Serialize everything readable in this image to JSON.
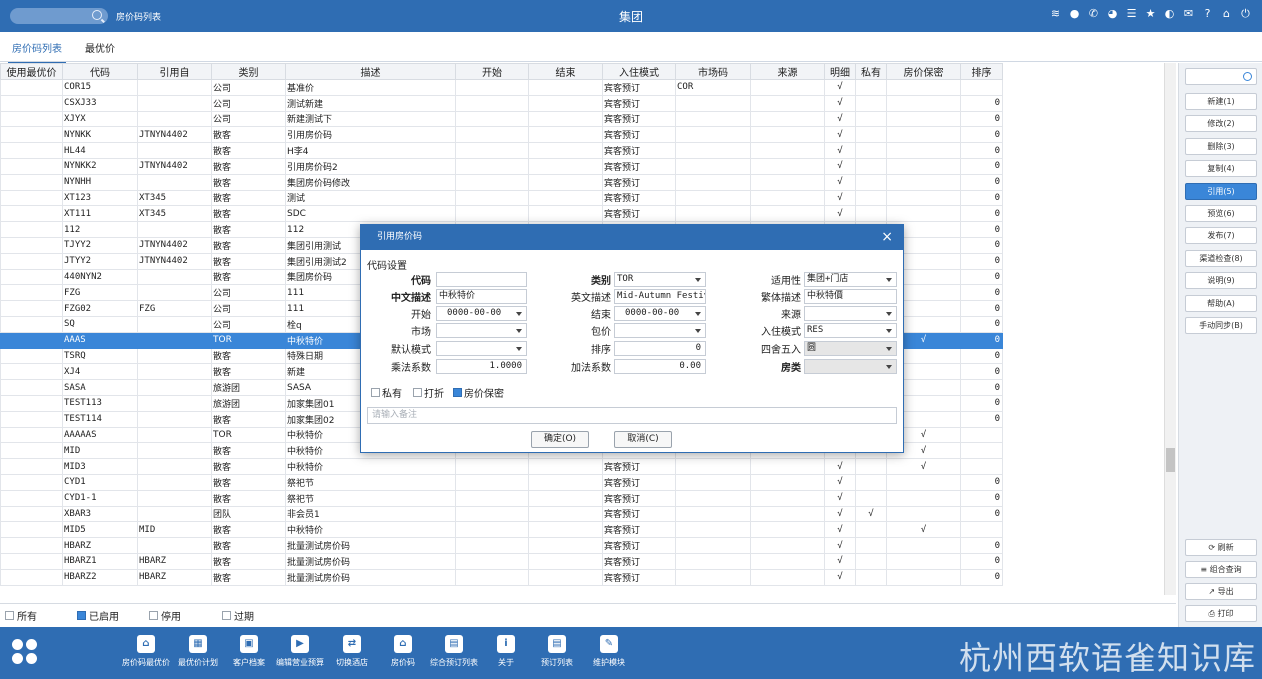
{
  "topbar": {
    "title": "房价码列表",
    "center_title": "集团",
    "icons": [
      "wifi-icon",
      "chat-icon",
      "phone-icon",
      "palette-icon",
      "menu-icon",
      "star-icon",
      "contrast-icon",
      "mail-icon",
      "help-icon",
      "home-icon",
      "power-icon"
    ]
  },
  "tabs": [
    "房价码列表",
    "最优价"
  ],
  "grid": {
    "columns": [
      "使用最优价",
      "代码",
      "引用自",
      "类别",
      "描述",
      "开始",
      "结束",
      "入住模式",
      "市场码",
      "来源",
      "明细",
      "私有",
      "房价保密",
      "排序"
    ],
    "rows": [
      {
        "code": "COR15",
        "ref": "",
        "cat": "公司",
        "desc": "基准价",
        "mode": "宾客预订",
        "market": "COR",
        "detail": "√",
        "private": "",
        "secret": "",
        "sort": ""
      },
      {
        "code": "CSXJ33",
        "ref": "",
        "cat": "公司",
        "desc": "测试新建",
        "mode": "宾客预订",
        "market": "",
        "detail": "√",
        "private": "",
        "secret": "",
        "sort": "0"
      },
      {
        "code": "XJYX",
        "ref": "",
        "cat": "公司",
        "desc": "新建测试下",
        "mode": "宾客预订",
        "market": "",
        "detail": "√",
        "private": "",
        "secret": "",
        "sort": "0"
      },
      {
        "code": "NYNKK",
        "ref": "JTNYN4402",
        "cat": "散客",
        "desc": "引用房价码",
        "mode": "宾客预订",
        "market": "",
        "detail": "√",
        "private": "",
        "secret": "",
        "sort": "0"
      },
      {
        "code": "HL44",
        "ref": "",
        "cat": "散客",
        "desc": "H李4",
        "mode": "宾客预订",
        "market": "",
        "detail": "√",
        "private": "",
        "secret": "",
        "sort": "0"
      },
      {
        "code": "NYNKK2",
        "ref": "JTNYN4402",
        "cat": "散客",
        "desc": "引用房价码2",
        "mode": "宾客预订",
        "market": "",
        "detail": "√",
        "private": "",
        "secret": "",
        "sort": "0"
      },
      {
        "code": "NYNHH",
        "ref": "",
        "cat": "散客",
        "desc": "集团房价码修改",
        "mode": "宾客预订",
        "market": "",
        "detail": "√",
        "private": "",
        "secret": "",
        "sort": "0"
      },
      {
        "code": "XT123",
        "ref": "XT345",
        "cat": "散客",
        "desc": "测试",
        "mode": "宾客预订",
        "market": "",
        "detail": "√",
        "private": "",
        "secret": "",
        "sort": "0"
      },
      {
        "code": "XT111",
        "ref": "XT345",
        "cat": "散客",
        "desc": "SDC",
        "mode": "宾客预订",
        "market": "",
        "detail": "√",
        "private": "",
        "secret": "",
        "sort": "0"
      },
      {
        "code": "112",
        "ref": "",
        "cat": "散客",
        "desc": "112",
        "mode": "",
        "market": "",
        "detail": "",
        "private": "",
        "secret": "",
        "sort": "0"
      },
      {
        "code": "TJYY2",
        "ref": "JTNYN4402",
        "cat": "散客",
        "desc": "集团引用测试",
        "mode": "",
        "market": "",
        "detail": "",
        "private": "",
        "secret": "",
        "sort": "0"
      },
      {
        "code": "JTYY2",
        "ref": "JTNYN4402",
        "cat": "散客",
        "desc": "集团引用测试2",
        "mode": "",
        "market": "",
        "detail": "",
        "private": "",
        "secret": "",
        "sort": "0"
      },
      {
        "code": "440NYN2",
        "ref": "",
        "cat": "散客",
        "desc": "集团房价码",
        "mode": "",
        "market": "",
        "detail": "",
        "private": "",
        "secret": "",
        "sort": "0"
      },
      {
        "code": "FZG",
        "ref": "",
        "cat": "公司",
        "desc": "111",
        "mode": "",
        "market": "",
        "detail": "",
        "private": "",
        "secret": "",
        "sort": "0"
      },
      {
        "code": "FZG02",
        "ref": "FZG",
        "cat": "公司",
        "desc": "111",
        "mode": "",
        "market": "",
        "detail": "",
        "private": "",
        "secret": "",
        "sort": "0"
      },
      {
        "code": "SQ",
        "ref": "",
        "cat": "公司",
        "desc": "栓q",
        "mode": "",
        "market": "",
        "detail": "",
        "private": "",
        "secret": "",
        "sort": "0"
      },
      {
        "code": "AAAS",
        "ref": "",
        "cat": "TOR",
        "desc": "中秋特价",
        "mode": "",
        "market": "",
        "detail": "",
        "private": "",
        "secret": "√",
        "sort": "0",
        "selected": true
      },
      {
        "code": "TSRQ",
        "ref": "",
        "cat": "散客",
        "desc": "特殊日期",
        "mode": "",
        "market": "",
        "detail": "",
        "private": "",
        "secret": "",
        "sort": "0"
      },
      {
        "code": "XJ4",
        "ref": "",
        "cat": "散客",
        "desc": "新建",
        "mode": "",
        "market": "",
        "detail": "",
        "private": "",
        "secret": "",
        "sort": "0"
      },
      {
        "code": "SASA",
        "ref": "",
        "cat": "旅游团",
        "desc": "SASA",
        "mode": "",
        "market": "",
        "detail": "",
        "private": "",
        "secret": "",
        "sort": "0"
      },
      {
        "code": "TEST113",
        "ref": "",
        "cat": "旅游团",
        "desc": "加家集团01",
        "mode": "",
        "market": "",
        "detail": "",
        "private": "",
        "secret": "",
        "sort": "0"
      },
      {
        "code": "TEST114",
        "ref": "",
        "cat": "散客",
        "desc": "加家集团02",
        "mode": "",
        "market": "",
        "detail": "",
        "private": "",
        "secret": "",
        "sort": "0"
      },
      {
        "code": "AAAAAS",
        "ref": "",
        "cat": "TOR",
        "desc": "中秋特价",
        "mode": "",
        "market": "",
        "detail": "",
        "private": "",
        "secret": "√",
        "sort": ""
      },
      {
        "code": "MID",
        "ref": "",
        "cat": "散客",
        "desc": "中秋特价",
        "mode": "",
        "market": "",
        "detail": "",
        "private": "",
        "secret": "√",
        "sort": ""
      },
      {
        "code": "MID3",
        "ref": "",
        "cat": "散客",
        "desc": "中秋特价",
        "mode": "宾客预订",
        "market": "",
        "detail": "√",
        "private": "",
        "secret": "√",
        "sort": ""
      },
      {
        "code": "CYD1",
        "ref": "",
        "cat": "散客",
        "desc": "祭祀节",
        "mode": "宾客预订",
        "market": "",
        "detail": "√",
        "private": "",
        "secret": "",
        "sort": "0"
      },
      {
        "code": "CYD1-1",
        "ref": "",
        "cat": "散客",
        "desc": "祭祀节",
        "mode": "宾客预订",
        "market": "",
        "detail": "√",
        "private": "",
        "secret": "",
        "sort": "0"
      },
      {
        "code": "XBAR3",
        "ref": "",
        "cat": "团队",
        "desc": "非会员1",
        "mode": "宾客预订",
        "market": "",
        "detail": "√",
        "private": "√",
        "secret": "",
        "sort": "0"
      },
      {
        "code": "MID5",
        "ref": "MID",
        "cat": "散客",
        "desc": "中秋特价",
        "mode": "宾客预订",
        "market": "",
        "detail": "√",
        "private": "",
        "secret": "√",
        "sort": ""
      },
      {
        "code": "HBARZ",
        "ref": "",
        "cat": "散客",
        "desc": "批量测试房价码",
        "mode": "宾客预订",
        "market": "",
        "detail": "√",
        "private": "",
        "secret": "",
        "sort": "0"
      },
      {
        "code": "HBARZ1",
        "ref": "HBARZ",
        "cat": "散客",
        "desc": "批量测试房价码",
        "mode": "宾客预订",
        "market": "",
        "detail": "√",
        "private": "",
        "secret": "",
        "sort": "0"
      },
      {
        "code": "HBARZ2",
        "ref": "HBARZ",
        "cat": "散客",
        "desc": "批量测试房价码",
        "mode": "宾客预订",
        "market": "",
        "detail": "√",
        "private": "",
        "secret": "",
        "sort": "0"
      }
    ]
  },
  "right_panel": {
    "buttons": [
      "新建(1)",
      "修改(2)",
      "删除(3)",
      "复制(4)",
      "引用(5)",
      "预览(6)",
      "发布(7)",
      "渠道检查(8)",
      "说明(9)",
      "帮助(A)",
      "手动同步(B)"
    ],
    "bottom_buttons": [
      "刷新",
      "组合查询",
      "导出",
      "打印"
    ]
  },
  "filters": [
    {
      "label": "所有",
      "checked": false
    },
    {
      "label": "已启用",
      "checked": true
    },
    {
      "label": "停用",
      "checked": false
    },
    {
      "label": "过期",
      "checked": false
    }
  ],
  "bottombar": {
    "items": [
      "房价码最优价",
      "最优价计划",
      "客户档案",
      "编辑营业预算",
      "切换酒店",
      "房价码",
      "综合预订列表",
      "关于",
      "预订列表",
      "维护模块"
    ],
    "watermark": "杭州西软语雀知识库"
  },
  "dialog": {
    "title": "引用房价码",
    "section": "代码设置",
    "fields": {
      "code_label": "代码",
      "code_value": "",
      "category_label": "类别",
      "category_value": "TOR",
      "apply_label": "适用性",
      "apply_value": "集团+门店",
      "cn_desc_label": "中文描述",
      "cn_desc_value": "中秋特价",
      "en_desc_label": "英文描述",
      "en_desc_value": "Mid-Autumn Festiva",
      "tw_desc_label": "繁体描述",
      "tw_desc_value": "中秋特價",
      "start_label": "开始",
      "start_value": "0000-00-00",
      "end_label": "结束",
      "end_value": "0000-00-00",
      "source_label": "来源",
      "source_value": "",
      "market_label": "市场",
      "market_value": "",
      "package_label": "包价",
      "package_value": "",
      "checkin_label": "入住模式",
      "checkin_value": "RES",
      "default_mode_label": "默认模式",
      "default_mode_value": "",
      "sort_label": "排序",
      "sort_value": "0",
      "rounding_label": "四舍五入",
      "rounding_value": "圆",
      "mult_label": "乘法系数",
      "mult_value": "1.0000",
      "add_label": "加法系数",
      "add_value": "0.00",
      "roomtype_label": "房类",
      "roomtype_value": ""
    },
    "checks": [
      {
        "label": "私有",
        "checked": false
      },
      {
        "label": "打折",
        "checked": false
      },
      {
        "label": "房价保密",
        "checked": true
      }
    ],
    "remark_placeholder": "请输入备注",
    "ok_label": "确定(O)",
    "cancel_label": "取消(C)"
  }
}
